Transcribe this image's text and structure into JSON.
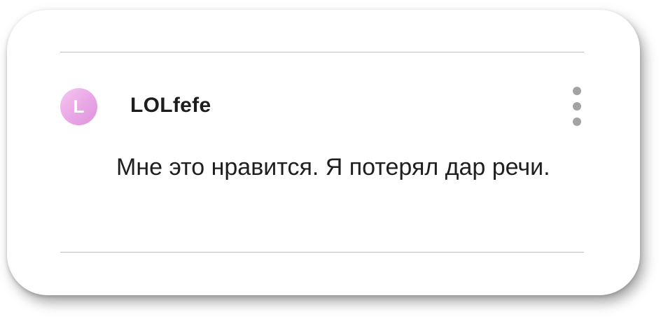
{
  "comment": {
    "avatar_letter": "L",
    "avatar_color": "#e9a6e6",
    "username": "LOLfefe",
    "text": "Мне это нравится. Я потерял дар речи.",
    "menu_icon": "vertical-ellipsis-icon"
  }
}
